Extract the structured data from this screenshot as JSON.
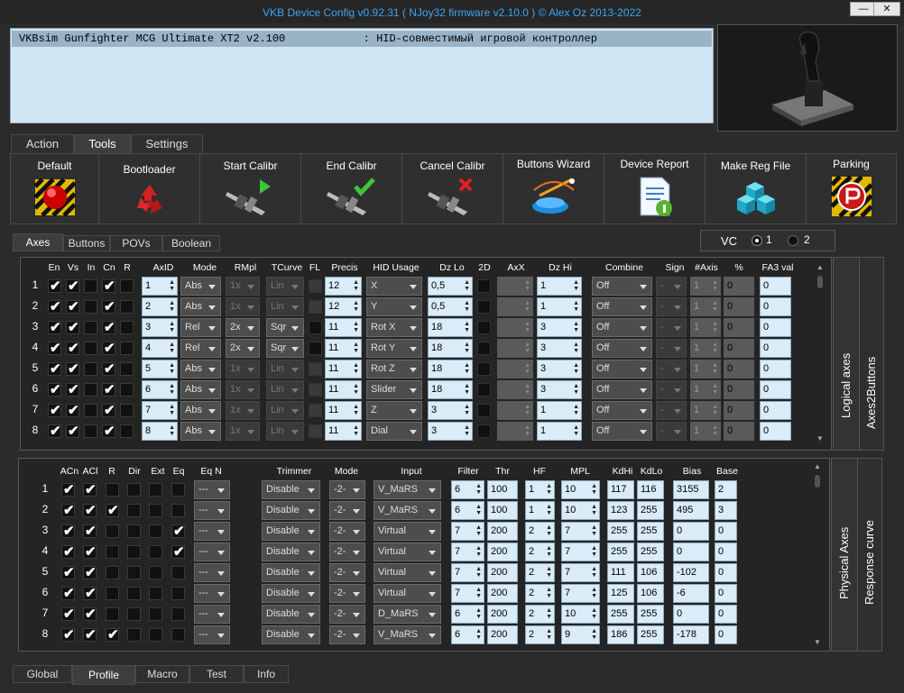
{
  "window": {
    "title": "VKB Device Config v0.92.31 ( NJoy32 firmware v2.10.0 ) © Alex Oz 2013-2022",
    "minimize": "—",
    "close": "✕"
  },
  "device": {
    "line": "VKBsim Gunfighter MCG Ultimate XT2 v2.100            : HID-совместимый игровой контроллер"
  },
  "main_tabs": [
    "Action",
    "Tools",
    "Settings"
  ],
  "tools": [
    {
      "label": "Default",
      "icon": "red-button-icon"
    },
    {
      "label": "Bootloader",
      "icon": "recycle-icon"
    },
    {
      "label": "Start Calibr",
      "icon": "caliper-play-icon"
    },
    {
      "label": "End Calibr",
      "icon": "caliper-check-icon"
    },
    {
      "label": "Cancel Calibr",
      "icon": "caliper-cancel-icon"
    },
    {
      "label": "Buttons Wizard",
      "icon": "wizard-icon"
    },
    {
      "label": "Device Report",
      "icon": "report-icon"
    },
    {
      "label": "Make Reg File",
      "icon": "registry-icon"
    },
    {
      "label": "Parking",
      "icon": "parking-icon"
    }
  ],
  "sub_tabs": [
    "Axes",
    "Buttons",
    "POVs",
    "Boolean"
  ],
  "vc": {
    "label": "VC",
    "opt1": "1",
    "opt2": "2"
  },
  "logical": {
    "headers": [
      "En",
      "Vs",
      "In",
      "Cn",
      "R",
      "AxID",
      "Mode",
      "RMpl",
      "TCurve",
      "FL",
      "Precis",
      "HID Usage",
      "Dz Lo",
      "2D",
      "AxX",
      "Dz Hi",
      "Combine",
      "Sign",
      "#Axis",
      "%",
      "FA3 val"
    ],
    "side_tabs": [
      "Logical axes",
      "Axes2Buttons"
    ],
    "rows": [
      {
        "n": "1",
        "en": 1,
        "vs": 1,
        "in": 0,
        "cn": 1,
        "r": 0,
        "axid": "1",
        "mode": "Abs",
        "rmpl": "1x",
        "rmpl_on": 0,
        "tcurve": "Lin",
        "tc_on": 0,
        "fl": 0,
        "precis": "12",
        "hid": "X",
        "dzlo": "0,5",
        "dzhi": "1",
        "combine": "Off",
        "sign": "-",
        "axis": "1",
        "pct": "0",
        "fa3": "0"
      },
      {
        "n": "2",
        "en": 1,
        "vs": 1,
        "in": 0,
        "cn": 1,
        "r": 0,
        "axid": "2",
        "mode": "Abs",
        "rmpl": "1x",
        "rmpl_on": 0,
        "tcurve": "Lin",
        "tc_on": 0,
        "fl": 0,
        "precis": "12",
        "hid": "Y",
        "dzlo": "0,5",
        "dzhi": "1",
        "combine": "Off",
        "sign": "-",
        "axis": "1",
        "pct": "0",
        "fa3": "0"
      },
      {
        "n": "3",
        "en": 1,
        "vs": 1,
        "in": 0,
        "cn": 1,
        "r": 0,
        "axid": "3",
        "mode": "Rel",
        "rmpl": "2x",
        "rmpl_on": 1,
        "tcurve": "Sqr",
        "tc_on": 1,
        "fl": 1,
        "precis": "11",
        "hid": "Rot X",
        "dzlo": "18",
        "dzhi": "3",
        "combine": "Off",
        "sign": "-",
        "axis": "1",
        "pct": "0",
        "fa3": "0"
      },
      {
        "n": "4",
        "en": 1,
        "vs": 1,
        "in": 0,
        "cn": 1,
        "r": 0,
        "axid": "4",
        "mode": "Rel",
        "rmpl": "2x",
        "rmpl_on": 1,
        "tcurve": "Sqr",
        "tc_on": 1,
        "fl": 1,
        "precis": "11",
        "hid": "Rot Y",
        "dzlo": "18",
        "dzhi": "3",
        "combine": "Off",
        "sign": "-",
        "axis": "1",
        "pct": "0",
        "fa3": "0"
      },
      {
        "n": "5",
        "en": 1,
        "vs": 1,
        "in": 0,
        "cn": 1,
        "r": 0,
        "axid": "5",
        "mode": "Abs",
        "rmpl": "1x",
        "rmpl_on": 0,
        "tcurve": "Lin",
        "tc_on": 0,
        "fl": 0,
        "precis": "11",
        "hid": "Rot Z",
        "dzlo": "18",
        "dzhi": "3",
        "combine": "Off",
        "sign": "-",
        "axis": "1",
        "pct": "0",
        "fa3": "0"
      },
      {
        "n": "6",
        "en": 1,
        "vs": 1,
        "in": 0,
        "cn": 1,
        "r": 0,
        "axid": "6",
        "mode": "Abs",
        "rmpl": "1x",
        "rmpl_on": 0,
        "tcurve": "Lin",
        "tc_on": 0,
        "fl": 0,
        "precis": "11",
        "hid": "Slider",
        "dzlo": "18",
        "dzhi": "3",
        "combine": "Off",
        "sign": "-",
        "axis": "1",
        "pct": "0",
        "fa3": "0"
      },
      {
        "n": "7",
        "en": 1,
        "vs": 1,
        "in": 0,
        "cn": 1,
        "r": 0,
        "axid": "7",
        "mode": "Abs",
        "rmpl": "1x",
        "rmpl_on": 0,
        "tcurve": "Lin",
        "tc_on": 0,
        "fl": 0,
        "precis": "11",
        "hid": "Z",
        "dzlo": "3",
        "dzhi": "1",
        "combine": "Off",
        "sign": "-",
        "axis": "1",
        "pct": "0",
        "fa3": "0"
      },
      {
        "n": "8",
        "en": 1,
        "vs": 1,
        "in": 0,
        "cn": 1,
        "r": 0,
        "axid": "8",
        "mode": "Abs",
        "rmpl": "1x",
        "rmpl_on": 0,
        "tcurve": "Lin",
        "tc_on": 0,
        "fl": 0,
        "precis": "11",
        "hid": "Dial",
        "dzlo": "3",
        "dzhi": "1",
        "combine": "Off",
        "sign": "-",
        "axis": "1",
        "pct": "0",
        "fa3": "0"
      }
    ]
  },
  "physical": {
    "headers": [
      "ACn",
      "ACl",
      "R",
      "Dir",
      "Ext",
      "Eq",
      "Eq N",
      "Trimmer",
      "Mode",
      "Input",
      "Filter",
      "Thr",
      "HF",
      "MPL",
      "KdHi",
      "KdLo",
      "Bias",
      "Base"
    ],
    "side_tabs": [
      "Physical Axes",
      "Response curve"
    ],
    "rows": [
      {
        "n": "1",
        "acn": 1,
        "acl": 1,
        "r": 0,
        "dir": 0,
        "ext": 0,
        "eq": 0,
        "eqn": "---",
        "trimmer": "Disable",
        "mode": "-2-",
        "input": "V_MaRS",
        "filter": "6",
        "thr": "100",
        "hf": "1",
        "mpl": "10",
        "kdhi": "117",
        "kdlo": "116",
        "bias": "3155",
        "base": "2"
      },
      {
        "n": "2",
        "acn": 1,
        "acl": 1,
        "r": 1,
        "dir": 0,
        "ext": 0,
        "eq": 0,
        "eqn": "---",
        "trimmer": "Disable",
        "mode": "-2-",
        "input": "V_MaRS",
        "filter": "6",
        "thr": "100",
        "hf": "1",
        "mpl": "10",
        "kdhi": "123",
        "kdlo": "255",
        "bias": "495",
        "base": "3"
      },
      {
        "n": "3",
        "acn": 1,
        "acl": 1,
        "r": 0,
        "dir": 0,
        "ext": 0,
        "eq": 1,
        "eqn": "---",
        "trimmer": "Disable",
        "mode": "-2-",
        "input": "Virtual",
        "filter": "7",
        "thr": "200",
        "hf": "2",
        "mpl": "7",
        "kdhi": "255",
        "kdlo": "255",
        "bias": "0",
        "base": "0"
      },
      {
        "n": "4",
        "acn": 1,
        "acl": 1,
        "r": 0,
        "dir": 0,
        "ext": 0,
        "eq": 1,
        "eqn": "---",
        "trimmer": "Disable",
        "mode": "-2-",
        "input": "Virtual",
        "filter": "7",
        "thr": "200",
        "hf": "2",
        "mpl": "7",
        "kdhi": "255",
        "kdlo": "255",
        "bias": "0",
        "base": "0"
      },
      {
        "n": "5",
        "acn": 1,
        "acl": 1,
        "r": 0,
        "dir": 0,
        "ext": 0,
        "eq": 0,
        "eqn": "---",
        "trimmer": "Disable",
        "mode": "-2-",
        "input": "Virtual",
        "filter": "7",
        "thr": "200",
        "hf": "2",
        "mpl": "7",
        "kdhi": "111",
        "kdlo": "106",
        "bias": "-102",
        "base": "0"
      },
      {
        "n": "6",
        "acn": 1,
        "acl": 1,
        "r": 0,
        "dir": 0,
        "ext": 0,
        "eq": 0,
        "eqn": "---",
        "trimmer": "Disable",
        "mode": "-2-",
        "input": "Virtual",
        "filter": "7",
        "thr": "200",
        "hf": "2",
        "mpl": "7",
        "kdhi": "125",
        "kdlo": "106",
        "bias": "-6",
        "base": "0"
      },
      {
        "n": "7",
        "acn": 1,
        "acl": 1,
        "r": 0,
        "dir": 0,
        "ext": 0,
        "eq": 0,
        "eqn": "---",
        "trimmer": "Disable",
        "mode": "-2-",
        "input": "D_MaRS",
        "filter": "6",
        "thr": "200",
        "hf": "2",
        "mpl": "10",
        "kdhi": "255",
        "kdlo": "255",
        "bias": "0",
        "base": "0"
      },
      {
        "n": "8",
        "acn": 1,
        "acl": 1,
        "r": 1,
        "dir": 0,
        "ext": 0,
        "eq": 0,
        "eqn": "---",
        "trimmer": "Disable",
        "mode": "-2-",
        "input": "V_MaRS",
        "filter": "6",
        "thr": "200",
        "hf": "2",
        "mpl": "9",
        "kdhi": "186",
        "kdlo": "255",
        "bias": "-178",
        "base": "0"
      }
    ]
  },
  "bottom_tabs": [
    "Global",
    "Profile",
    "Macro",
    "Test",
    "Info"
  ],
  "colors": {
    "title": "#3fa4f2",
    "field": "#d9ecf8",
    "background": "#2b2b2b"
  }
}
